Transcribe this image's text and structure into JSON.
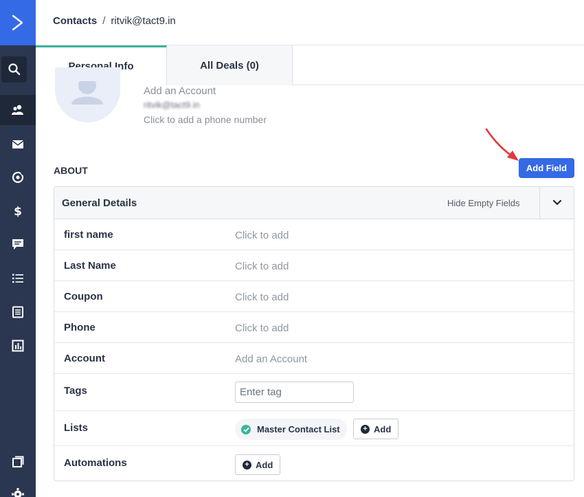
{
  "colors": {
    "rail": "#2b3750",
    "brand": "#356ae6",
    "accent_green": "#3bb59b"
  },
  "rail": {
    "icons": [
      "logo-chevron-icon",
      "search-icon",
      "contacts-icon",
      "email-icon",
      "automation-icon",
      "dollar-icon",
      "conversations-icon",
      "lists-icon",
      "forms-icon",
      "reports-icon",
      "pages-icon",
      "settings-icon"
    ]
  },
  "breadcrumb": {
    "parent": "Contacts",
    "separator": "/",
    "current": "ritvik@tact9.in"
  },
  "tabs": [
    {
      "label": "Personal Info"
    },
    {
      "label": "All Deals (0)"
    }
  ],
  "profile": {
    "account": "Add an Account",
    "email": "ritvik@tact9.in",
    "phone": "Click to add a phone number"
  },
  "about": {
    "title": "ABOUT",
    "add_field_label": "Add Field"
  },
  "details": {
    "title": "General Details",
    "hide_empty_label": "Hide Empty Fields",
    "rows": [
      {
        "label": "first name",
        "value": "Click to add"
      },
      {
        "label": "Last Name",
        "value": "Click to add"
      },
      {
        "label": "Coupon",
        "value": "Click to add"
      },
      {
        "label": "Phone",
        "value": "Click to add"
      },
      {
        "label": "Account",
        "value": "Add an Account"
      },
      {
        "label": "Tags",
        "placeholder": "Enter tag"
      },
      {
        "label": "Lists",
        "chip": "Master Contact List",
        "add_label": "Add"
      },
      {
        "label": "Automations",
        "add_label": "Add"
      }
    ]
  }
}
